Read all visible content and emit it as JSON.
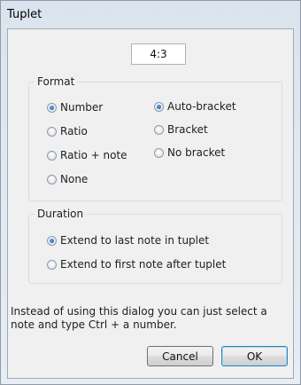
{
  "window": {
    "title": "Tuplet"
  },
  "ratio": {
    "value": "4:3"
  },
  "format": {
    "legend": "Format",
    "number_options": [
      {
        "label": "Number",
        "checked": true
      },
      {
        "label": "Ratio",
        "checked": false
      },
      {
        "label": "Ratio + note",
        "checked": false
      },
      {
        "label": "None",
        "checked": false
      }
    ],
    "bracket_options": [
      {
        "label": "Auto-bracket",
        "checked": true
      },
      {
        "label": "Bracket",
        "checked": false
      },
      {
        "label": "No bracket",
        "checked": false
      }
    ]
  },
  "duration": {
    "legend": "Duration",
    "options": [
      {
        "label": "Extend to last note in tuplet",
        "checked": true
      },
      {
        "label": "Extend to first note after tuplet",
        "checked": false
      }
    ]
  },
  "description": "Instead of using this dialog you can just select a note and type Ctrl + a number.",
  "buttons": {
    "cancel": "Cancel",
    "ok": "OK"
  }
}
